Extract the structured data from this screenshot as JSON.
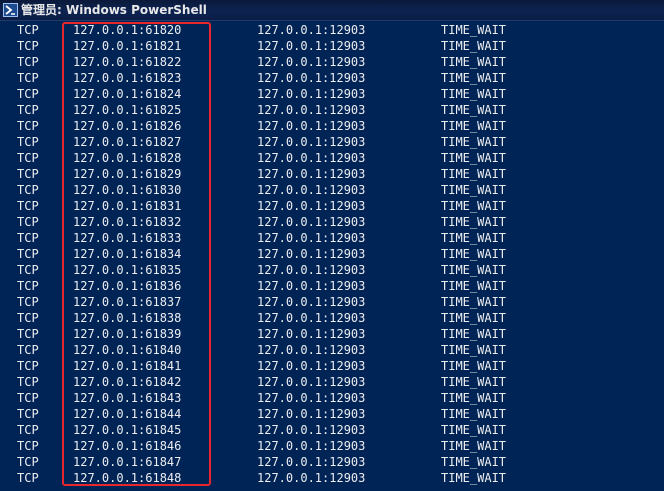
{
  "window": {
    "title": "管理员: Windows PowerShell",
    "icon": "powershell-icon"
  },
  "colors": {
    "console_background": "#012456",
    "console_text": "#eeedf0",
    "highlight_border": "#e8262d"
  },
  "connections": [
    {
      "proto": "TCP",
      "local": "127.0.0.1:61820",
      "foreign": "127.0.0.1:12903",
      "state": "TIME_WAIT"
    },
    {
      "proto": "TCP",
      "local": "127.0.0.1:61821",
      "foreign": "127.0.0.1:12903",
      "state": "TIME_WAIT"
    },
    {
      "proto": "TCP",
      "local": "127.0.0.1:61822",
      "foreign": "127.0.0.1:12903",
      "state": "TIME_WAIT"
    },
    {
      "proto": "TCP",
      "local": "127.0.0.1:61823",
      "foreign": "127.0.0.1:12903",
      "state": "TIME_WAIT"
    },
    {
      "proto": "TCP",
      "local": "127.0.0.1:61824",
      "foreign": "127.0.0.1:12903",
      "state": "TIME_WAIT"
    },
    {
      "proto": "TCP",
      "local": "127.0.0.1:61825",
      "foreign": "127.0.0.1:12903",
      "state": "TIME_WAIT"
    },
    {
      "proto": "TCP",
      "local": "127.0.0.1:61826",
      "foreign": "127.0.0.1:12903",
      "state": "TIME_WAIT"
    },
    {
      "proto": "TCP",
      "local": "127.0.0.1:61827",
      "foreign": "127.0.0.1:12903",
      "state": "TIME_WAIT"
    },
    {
      "proto": "TCP",
      "local": "127.0.0.1:61828",
      "foreign": "127.0.0.1:12903",
      "state": "TIME_WAIT"
    },
    {
      "proto": "TCP",
      "local": "127.0.0.1:61829",
      "foreign": "127.0.0.1:12903",
      "state": "TIME_WAIT"
    },
    {
      "proto": "TCP",
      "local": "127.0.0.1:61830",
      "foreign": "127.0.0.1:12903",
      "state": "TIME_WAIT"
    },
    {
      "proto": "TCP",
      "local": "127.0.0.1:61831",
      "foreign": "127.0.0.1:12903",
      "state": "TIME_WAIT"
    },
    {
      "proto": "TCP",
      "local": "127.0.0.1:61832",
      "foreign": "127.0.0.1:12903",
      "state": "TIME_WAIT"
    },
    {
      "proto": "TCP",
      "local": "127.0.0.1:61833",
      "foreign": "127.0.0.1:12903",
      "state": "TIME_WAIT"
    },
    {
      "proto": "TCP",
      "local": "127.0.0.1:61834",
      "foreign": "127.0.0.1:12903",
      "state": "TIME_WAIT"
    },
    {
      "proto": "TCP",
      "local": "127.0.0.1:61835",
      "foreign": "127.0.0.1:12903",
      "state": "TIME_WAIT"
    },
    {
      "proto": "TCP",
      "local": "127.0.0.1:61836",
      "foreign": "127.0.0.1:12903",
      "state": "TIME_WAIT"
    },
    {
      "proto": "TCP",
      "local": "127.0.0.1:61837",
      "foreign": "127.0.0.1:12903",
      "state": "TIME_WAIT"
    },
    {
      "proto": "TCP",
      "local": "127.0.0.1:61838",
      "foreign": "127.0.0.1:12903",
      "state": "TIME_WAIT"
    },
    {
      "proto": "TCP",
      "local": "127.0.0.1:61839",
      "foreign": "127.0.0.1:12903",
      "state": "TIME_WAIT"
    },
    {
      "proto": "TCP",
      "local": "127.0.0.1:61840",
      "foreign": "127.0.0.1:12903",
      "state": "TIME_WAIT"
    },
    {
      "proto": "TCP",
      "local": "127.0.0.1:61841",
      "foreign": "127.0.0.1:12903",
      "state": "TIME_WAIT"
    },
    {
      "proto": "TCP",
      "local": "127.0.0.1:61842",
      "foreign": "127.0.0.1:12903",
      "state": "TIME_WAIT"
    },
    {
      "proto": "TCP",
      "local": "127.0.0.1:61843",
      "foreign": "127.0.0.1:12903",
      "state": "TIME_WAIT"
    },
    {
      "proto": "TCP",
      "local": "127.0.0.1:61844",
      "foreign": "127.0.0.1:12903",
      "state": "TIME_WAIT"
    },
    {
      "proto": "TCP",
      "local": "127.0.0.1:61845",
      "foreign": "127.0.0.1:12903",
      "state": "TIME_WAIT"
    },
    {
      "proto": "TCP",
      "local": "127.0.0.1:61846",
      "foreign": "127.0.0.1:12903",
      "state": "TIME_WAIT"
    },
    {
      "proto": "TCP",
      "local": "127.0.0.1:61847",
      "foreign": "127.0.0.1:12903",
      "state": "TIME_WAIT"
    },
    {
      "proto": "TCP",
      "local": "127.0.0.1:61848",
      "foreign": "127.0.0.1:12903",
      "state": "TIME_WAIT"
    }
  ]
}
